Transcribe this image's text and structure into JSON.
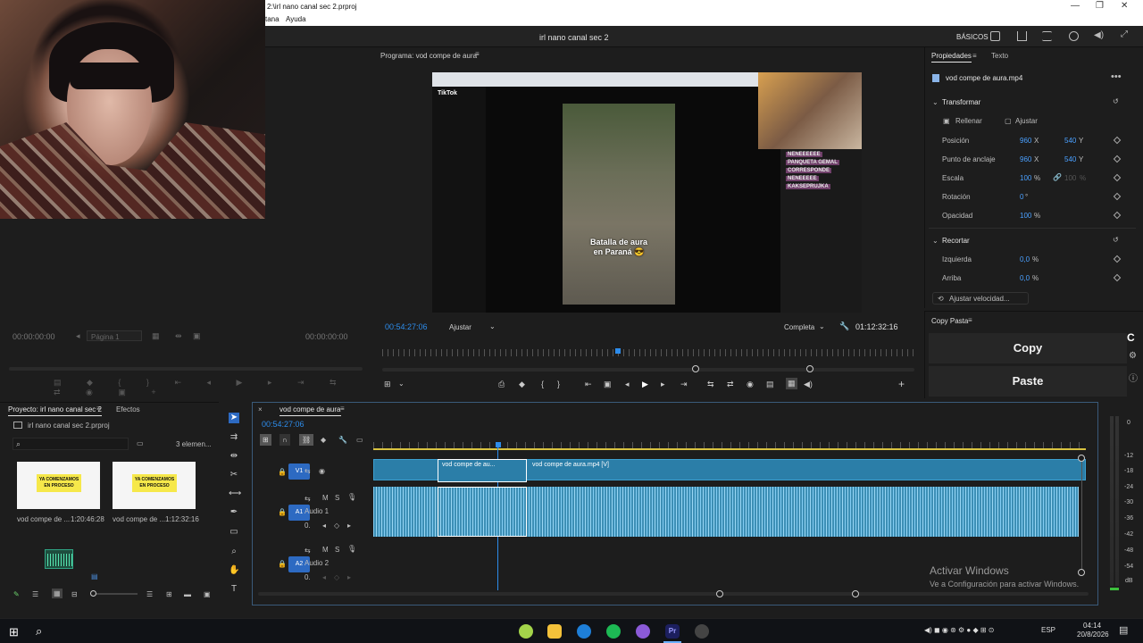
{
  "window": {
    "title": "2:\\irl nano canal sec 2.prproj",
    "menu": [
      "tana",
      "Ayuda"
    ],
    "project_title": "irl nano canal sec 2",
    "workspace": "BÁSICOS"
  },
  "source_monitor": {
    "timecode_left": "00:00:00:00",
    "timecode_right": "00:00:00:00",
    "page_select": "Página 1"
  },
  "program_monitor": {
    "label": "Programa: vod compe de aura",
    "timecode": "00:54:27:06",
    "fit": "Ajustar",
    "quality": "Completa",
    "duration": "01:12:32:16",
    "video_caption_line1": "Batalla de aura",
    "video_caption_line2": "en Paraná 😎",
    "tiktok_label": "TikTok",
    "chat_names": [
      "NENEEEEEE",
      "PANQUETA GEMAL",
      "CORRESPONDE",
      "NENEEEEE",
      "KAKSEPRUJKA"
    ]
  },
  "properties": {
    "tab_active": "Propiedades",
    "tab_other": "Texto",
    "clip_name": "vod compe de aura.mp4",
    "section_transform": "Transformar",
    "fill": "Rellenar",
    "fit": "Ajustar",
    "rows": [
      {
        "label": "Posición",
        "v1": "960",
        "u1": "X",
        "v2": "540",
        "u2": "Y"
      },
      {
        "label": "Punto de anclaje",
        "v1": "960",
        "u1": "X",
        "v2": "540",
        "u2": "Y"
      },
      {
        "label": "Escala",
        "v1": "100",
        "u1": "%",
        "v2": "100",
        "u2": "%"
      },
      {
        "label": "Rotación",
        "v1": "0",
        "u1": "°"
      },
      {
        "label": "Opacidad",
        "v1": "100",
        "u1": "%"
      }
    ],
    "section_crop": "Recortar",
    "crop_rows": [
      {
        "label": "Izquierda",
        "v1": "0,0",
        "u1": "%"
      },
      {
        "label": "Arriba",
        "v1": "0,0",
        "u1": "%"
      }
    ],
    "speed_button": "Ajustar velocidad..."
  },
  "copy_paste": {
    "title": "Copy Pasta",
    "copy": "Copy",
    "paste": "Paste"
  },
  "project": {
    "tab_project": "Proyecto: irl nano canal sec 2",
    "tab_effects": "Efectos",
    "file": "irl nano canal sec 2.prproj",
    "count": "3 elemen...",
    "items": [
      {
        "name": "vod compe de ...",
        "duration": "1:20:46:28",
        "thumb_text": "YA COMENZAMOS EN PROCESO"
      },
      {
        "name": "vod compe de ...",
        "duration": "1:12:32:16",
        "thumb_text": "YA COMENZAMOS EN PROCESO"
      }
    ]
  },
  "timeline": {
    "sequence": "vod compe de aura",
    "timecode": "00:54:27:06",
    "clip_short": "vod compe de au...",
    "clip_main": "vod compe de aura.mp4 [V]",
    "tracks": [
      {
        "id": "V1",
        "name": ""
      },
      {
        "id": "A1",
        "name": "Audio 1"
      },
      {
        "id": "A2",
        "name": "Audio 2"
      }
    ],
    "meter_labels": [
      "0",
      "-12",
      "-18",
      "-24",
      "-30",
      "-36",
      "-42",
      "-48",
      "-54",
      "dB"
    ]
  },
  "activation": {
    "title": "Activar Windows",
    "subtitle": "Ve a Configuración para activar Windows."
  },
  "taskbar": {
    "lang": "ESP",
    "time": "04:14",
    "date": "20/8/2026"
  }
}
